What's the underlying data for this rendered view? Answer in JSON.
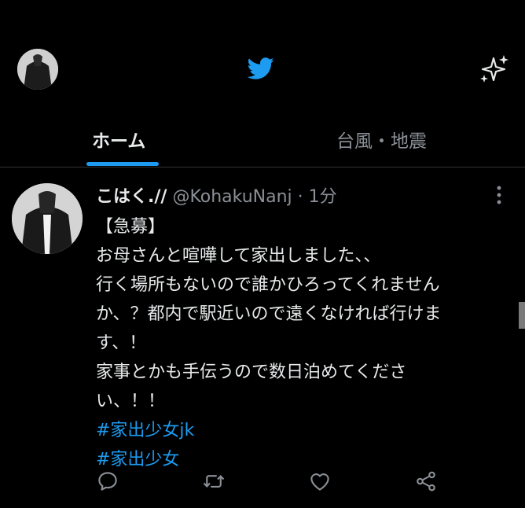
{
  "header": {
    "avatar_icon": "profile-avatar-icon",
    "logo_icon": "twitter-bird-icon",
    "sparkle_icon": "sparkle-icon",
    "brand_color": "#1d9bf0"
  },
  "tabs": [
    {
      "label": "ホーム",
      "active": true
    },
    {
      "label": "台風・地震",
      "active": false
    }
  ],
  "tweet": {
    "display_name": "こはく.//",
    "handle": "@KohakuNanj",
    "separator": "·",
    "time": "1分",
    "lines": [
      "【急募】",
      "お母さんと喧嘩して家出しました、、",
      "行く場所もないので誰かひろってくれません",
      "か、？都内で駅近いので遠くなければ行けま",
      "す、！",
      "家事とかも手伝うので数日泊めてくださ",
      "い、！！"
    ],
    "hashtags": [
      "#家出少女jk",
      "#家出少女"
    ]
  },
  "actions": {
    "reply_icon": "reply-icon",
    "retweet_icon": "retweet-icon",
    "like_icon": "like-icon",
    "share_icon": "share-icon"
  }
}
